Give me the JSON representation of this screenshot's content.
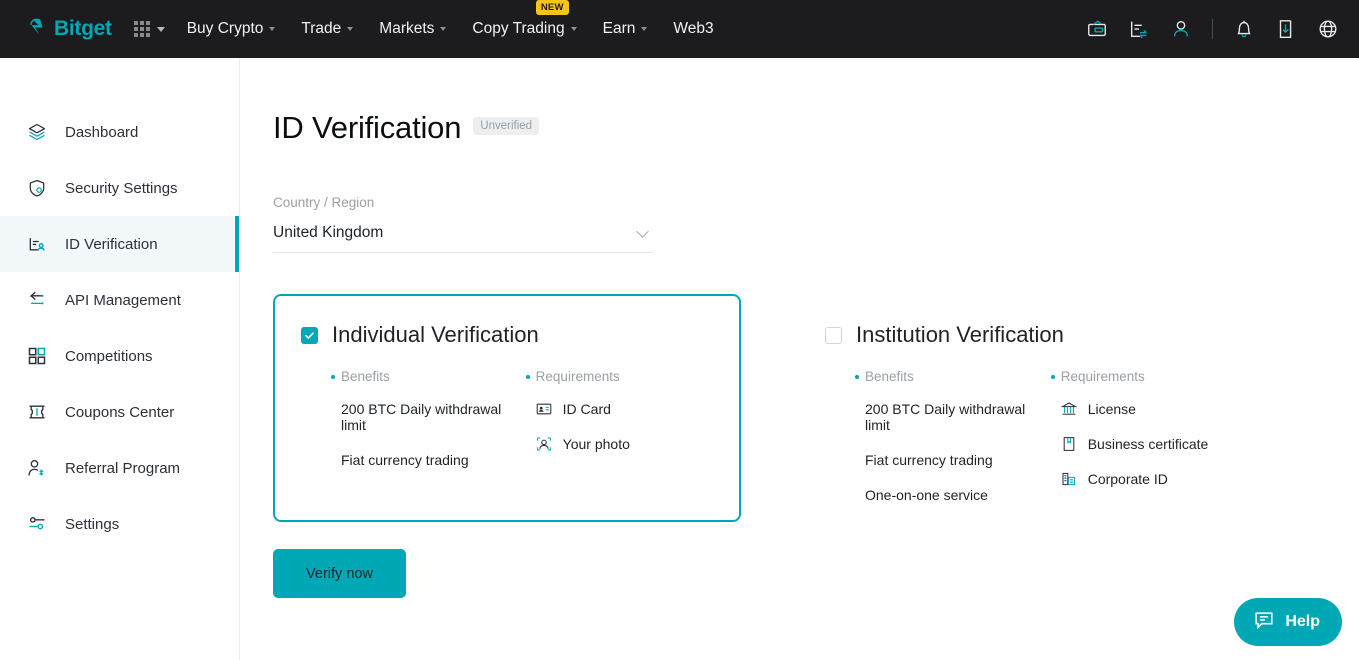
{
  "brand": {
    "name": "Bitget",
    "accent": "#00a7b5",
    "nav_bg": "#1c1c1e"
  },
  "topnav": {
    "items": [
      {
        "label": "Buy Crypto",
        "has_caret": true,
        "badge": ""
      },
      {
        "label": "Trade",
        "has_caret": true,
        "badge": ""
      },
      {
        "label": "Markets",
        "has_caret": true,
        "badge": ""
      },
      {
        "label": "Copy Trading",
        "has_caret": true,
        "badge": "NEW"
      },
      {
        "label": "Earn",
        "has_caret": true,
        "badge": ""
      },
      {
        "label": "Web3",
        "has_caret": false,
        "badge": ""
      }
    ]
  },
  "sidebar": {
    "items": [
      {
        "label": "Dashboard",
        "icon": "layers-icon",
        "active": false
      },
      {
        "label": "Security Settings",
        "icon": "shield-icon",
        "active": false
      },
      {
        "label": "ID Verification",
        "icon": "id-card-person-icon",
        "active": true
      },
      {
        "label": "API Management",
        "icon": "api-arrows-icon",
        "active": false
      },
      {
        "label": "Competitions",
        "icon": "squares-icon",
        "active": false
      },
      {
        "label": "Coupons Center",
        "icon": "ticket-icon",
        "active": false
      },
      {
        "label": "Referral Program",
        "icon": "person-share-icon",
        "active": false
      },
      {
        "label": "Settings",
        "icon": "sliders-icon",
        "active": false
      }
    ]
  },
  "page": {
    "title": "ID Verification",
    "status": "Unverified",
    "country": {
      "label": "Country / Region",
      "value": "United Kingdom"
    },
    "verify_button": "Verify now"
  },
  "cards": {
    "individual": {
      "title": "Individual Verification",
      "selected": true,
      "benefits_heading": "Benefits",
      "requirements_heading": "Requirements",
      "benefits": [
        "200 BTC Daily withdrawal limit",
        "Fiat currency trading"
      ],
      "requirements": [
        {
          "label": "ID Card",
          "icon": "id-card-icon"
        },
        {
          "label": "Your photo",
          "icon": "face-scan-icon"
        }
      ]
    },
    "institution": {
      "title": "Institution Verification",
      "selected": false,
      "benefits_heading": "Benefits",
      "requirements_heading": "Requirements",
      "benefits": [
        "200 BTC Daily withdrawal limit",
        "Fiat currency trading",
        "One-on-one service"
      ],
      "requirements": [
        {
          "label": "License",
          "icon": "bank-icon"
        },
        {
          "label": "Business certificate",
          "icon": "certificate-icon"
        },
        {
          "label": "Corporate ID",
          "icon": "building-icon"
        }
      ]
    }
  },
  "help": {
    "label": "Help",
    "icon": "chat-bubble-icon"
  }
}
